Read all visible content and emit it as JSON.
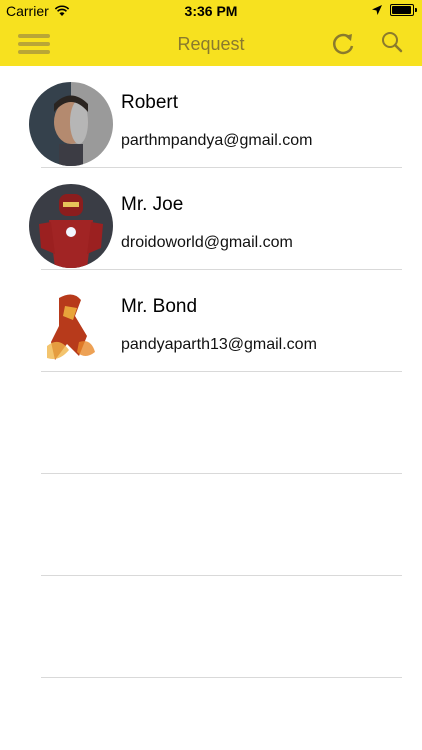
{
  "status_bar": {
    "carrier": "Carrier",
    "time": "3:36 PM",
    "battery_level": 0.95
  },
  "nav": {
    "title": "Request",
    "icons": [
      "menu-icon",
      "refresh-icon",
      "search-icon"
    ],
    "accent_color": "#f7e11f"
  },
  "requests": [
    {
      "name": "Robert",
      "email": "parthmpandya@gmail.com"
    },
    {
      "name": "Mr. Joe",
      "email": "droidoworld@gmail.com"
    },
    {
      "name": "Mr. Bond",
      "email": "pandyaparth13@gmail.com"
    }
  ]
}
